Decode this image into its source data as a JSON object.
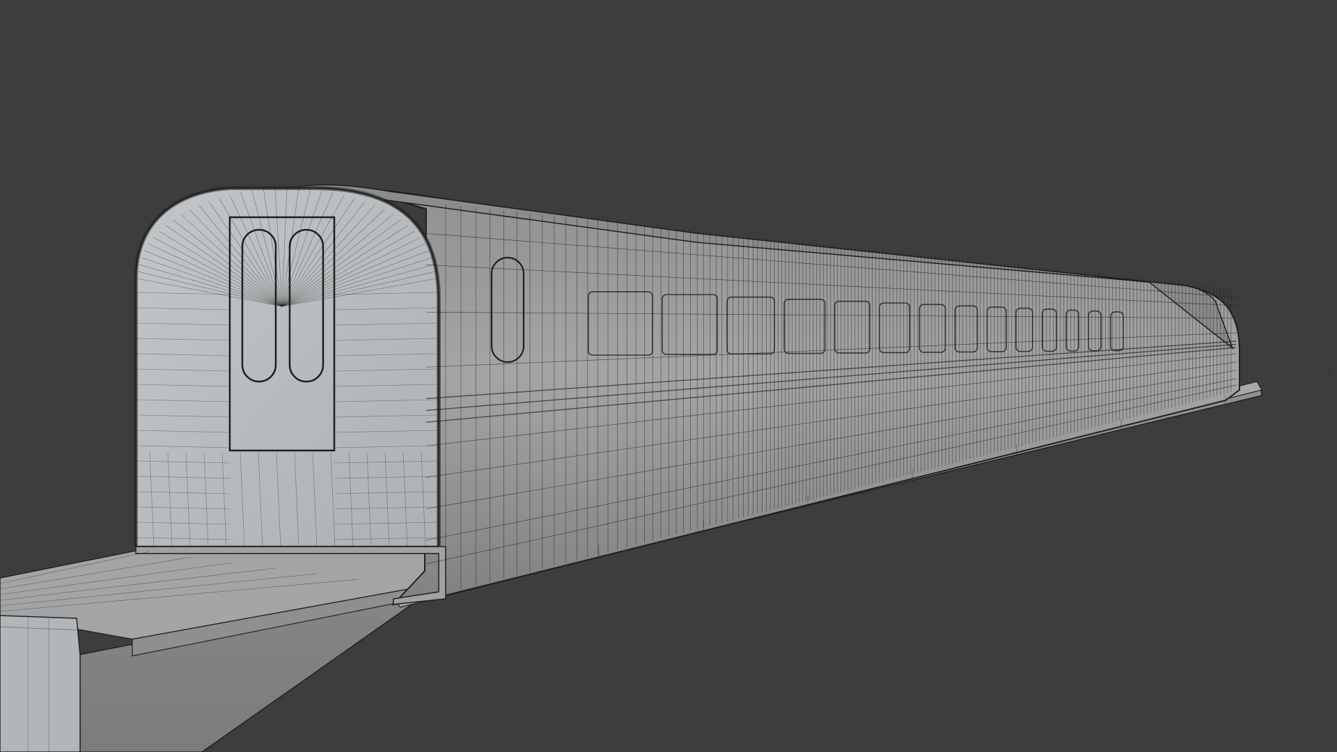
{
  "viewport": {
    "background_color": "#3d3d3d",
    "view_mode": "wireframe-overlay",
    "subject": "monorail-train-car-model"
  },
  "colors": {
    "surface_light": "#b9bcbe",
    "surface_mid": "#9a9c9d",
    "surface_dark": "#7c7e7f",
    "beam_side": "#8e8f8f",
    "beam_top": "#a9abab",
    "wire": "#1d1d1d"
  }
}
